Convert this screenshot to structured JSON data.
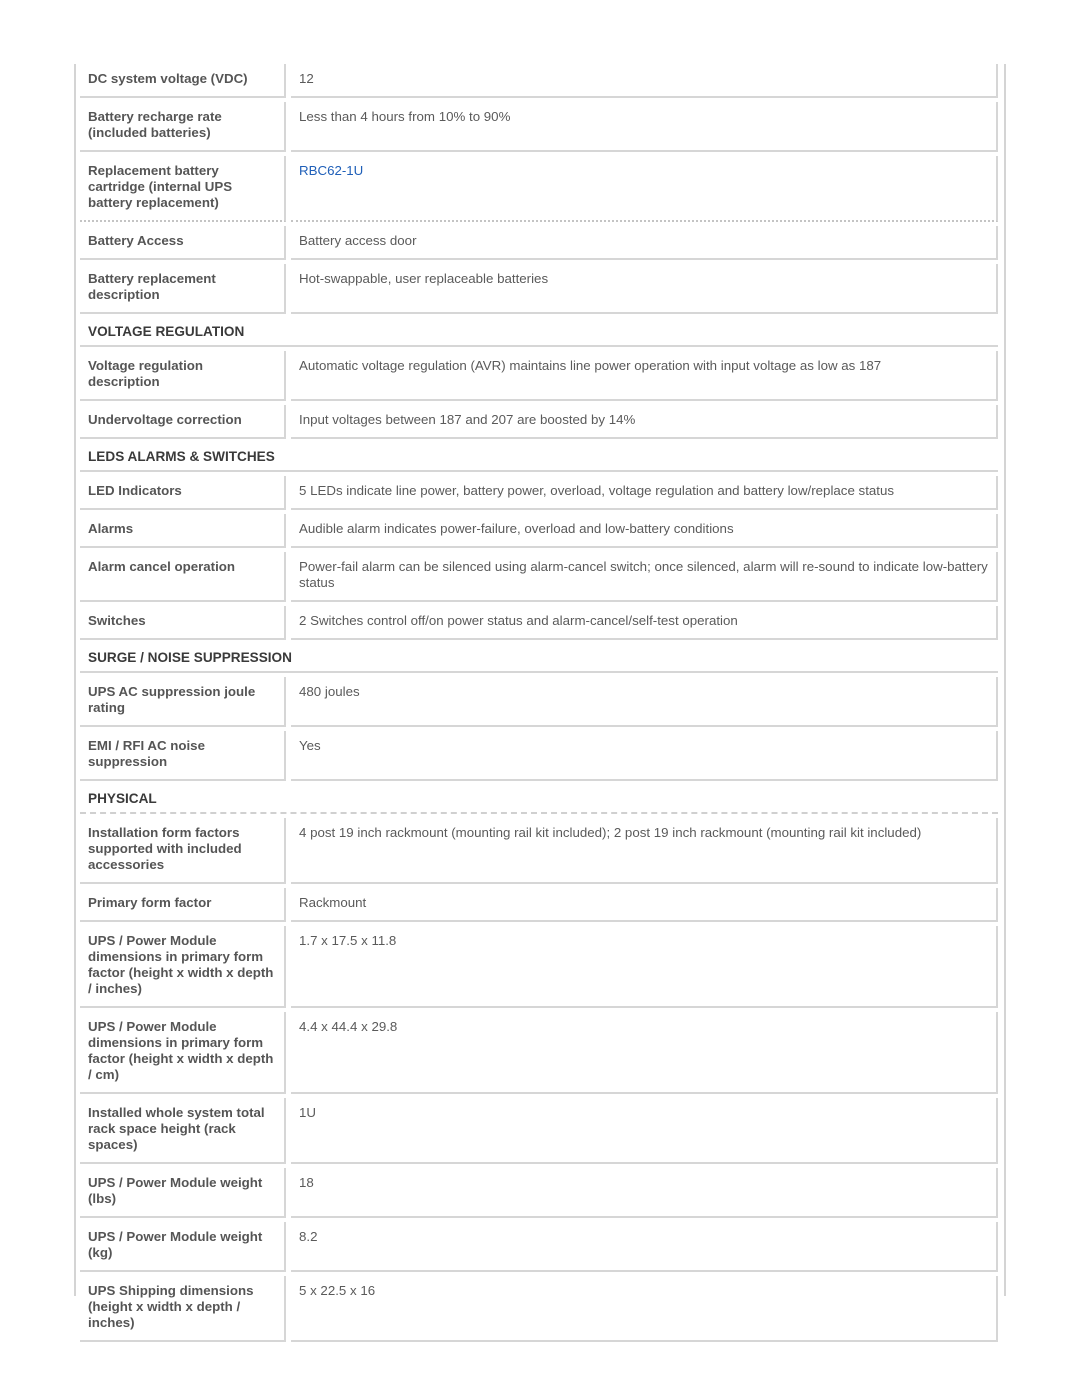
{
  "rows_top": [
    {
      "label": "DC system voltage (VDC)",
      "value": "12",
      "h": 1
    },
    {
      "label": "Battery recharge rate (included batteries)",
      "value": "Less than 4 hours from 10% to 90%",
      "h": 2
    },
    {
      "label": "Replacement battery cartridge (internal UPS battery replacement)",
      "value": "RBC62-1U",
      "link": true,
      "h": 3
    },
    {
      "label": "Battery Access",
      "value": "Battery access door",
      "h": 1
    },
    {
      "label": "Battery replacement description",
      "value": "Hot-swappable, user replaceable batteries",
      "h": 2
    }
  ],
  "sections": [
    {
      "title": "VOLTAGE REGULATION",
      "rows": [
        {
          "label": "Voltage regulation description",
          "value": "Automatic voltage regulation (AVR) maintains line power operation with input voltage as low as 187",
          "h": 2
        },
        {
          "label": "Undervoltage correction",
          "value": "Input voltages between 187 and 207 are boosted by 14%",
          "h": 1
        }
      ]
    },
    {
      "title": "LEDS ALARMS & SWITCHES",
      "rows": [
        {
          "label": "LED Indicators",
          "value": "5 LEDs indicate line power, battery power, overload, voltage regulation and battery low/replace status",
          "h": 1
        },
        {
          "label": "Alarms",
          "value": "Audible alarm indicates power-failure, overload and low-battery conditions",
          "h": 1
        },
        {
          "label": "Alarm cancel operation",
          "value": "Power-fail alarm can be silenced using alarm-cancel switch; once silenced, alarm will re-sound to indicate low-battery status",
          "h": 2
        },
        {
          "label": "Switches",
          "value": "2 Switches control off/on power status and alarm-cancel/self-test operation",
          "h": 1
        }
      ]
    },
    {
      "title": "SURGE / NOISE SUPPRESSION",
      "rows": [
        {
          "label": "UPS AC suppression joule rating",
          "value": "480 joules",
          "h": 2
        },
        {
          "label": "EMI / RFI AC noise suppression",
          "value": "Yes",
          "h": 2
        }
      ]
    },
    {
      "title": "PHYSICAL",
      "rows": [
        {
          "label": "Installation form factors supported with included accessories",
          "value": "4 post 19 inch rackmount (mounting rail kit included); 2 post 19 inch rackmount (mounting rail kit included)",
          "h": 3
        },
        {
          "label": "Primary form factor",
          "value": "Rackmount",
          "h": 1
        },
        {
          "label": "UPS / Power Module dimensions in primary form factor (height x width x depth / inches)",
          "value": "1.7 x 17.5 x 11.8",
          "h": 4
        },
        {
          "label": "UPS / Power Module dimensions in primary form factor (height x width x depth / cm)",
          "value": "4.4 x 44.4 x 29.8",
          "h": 4
        },
        {
          "label": "Installed whole system total rack space height (rack spaces)",
          "value": "1U",
          "h": 3
        },
        {
          "label": "UPS / Power Module weight (lbs)",
          "value": "18",
          "h": 2
        },
        {
          "label": "UPS / Power Module weight (kg)",
          "value": "8.2",
          "h": 2
        },
        {
          "label": "UPS Shipping dimensions (height x width x depth / inches)",
          "value": "5 x 22.5 x 16",
          "h": 3
        }
      ]
    }
  ]
}
